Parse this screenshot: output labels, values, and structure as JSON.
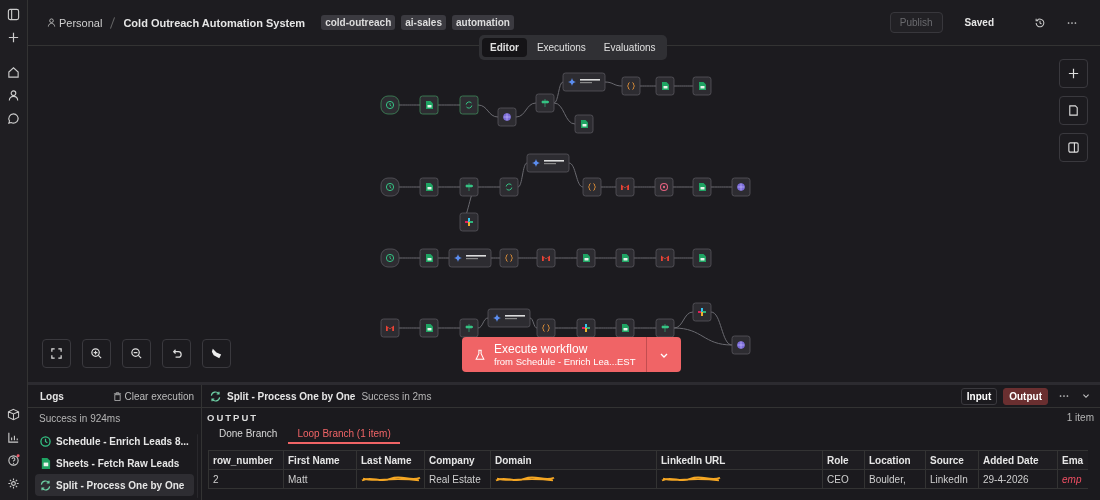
{
  "breadcrumb": {
    "owner": "Personal",
    "title": "Cold Outreach Automation System"
  },
  "tags": [
    "cold-outreach",
    "ai-sales",
    "automation"
  ],
  "actions": {
    "publish": {
      "label": "Publish",
      "disabled": true
    },
    "saved": "Saved"
  },
  "view_tabs": [
    {
      "label": "Editor",
      "selected": true
    },
    {
      "label": "Executions",
      "selected": false
    },
    {
      "label": "Evaluations",
      "selected": false
    }
  ],
  "workflows": [
    {
      "nodes": [
        {
          "kind": "schedule"
        },
        {
          "kind": "sheets"
        },
        {
          "kind": "split"
        },
        {
          "kind": "http"
        },
        {
          "kind": "if"
        },
        {
          "kind": "ai"
        },
        {
          "kind": "code"
        },
        {
          "kind": "sheets"
        },
        {
          "kind": "sheets"
        },
        {
          "kind": "sheets"
        }
      ]
    },
    {
      "nodes": [
        {
          "kind": "schedule"
        },
        {
          "kind": "sheets"
        },
        {
          "kind": "if"
        },
        {
          "kind": "split"
        },
        {
          "kind": "ai"
        },
        {
          "kind": "code"
        },
        {
          "kind": "gmail"
        },
        {
          "kind": "wait"
        },
        {
          "kind": "sheets"
        },
        {
          "kind": "http"
        },
        {
          "kind": "slack"
        }
      ]
    },
    {
      "nodes": [
        {
          "kind": "schedule"
        },
        {
          "kind": "sheets"
        },
        {
          "kind": "ai"
        },
        {
          "kind": "code"
        },
        {
          "kind": "gmail"
        },
        {
          "kind": "sheets"
        },
        {
          "kind": "sheets"
        },
        {
          "kind": "gmail"
        },
        {
          "kind": "sheets"
        }
      ]
    },
    {
      "nodes": [
        {
          "kind": "gmail"
        },
        {
          "kind": "sheets"
        },
        {
          "kind": "if"
        },
        {
          "kind": "ai"
        },
        {
          "kind": "code"
        },
        {
          "kind": "slack"
        },
        {
          "kind": "sheets"
        },
        {
          "kind": "if"
        },
        {
          "kind": "slack"
        },
        {
          "kind": "http"
        }
      ]
    }
  ],
  "execute": {
    "label": "Execute workflow",
    "source": "from Schedule - Enrich Lea...EST"
  },
  "logs": {
    "title": "Logs",
    "clear": "Clear execution",
    "summary": "Success in 924ms",
    "items": [
      {
        "kind": "schedule",
        "label": "Schedule - Enrich Leads 8...",
        "selected": false
      },
      {
        "kind": "sheets",
        "label": "Sheets - Fetch Raw Leads",
        "selected": false
      },
      {
        "kind": "split",
        "label": "Split - Process One by One",
        "selected": true
      }
    ]
  },
  "detail": {
    "node": "Split - Process One by One",
    "status": "Success in 2ms",
    "modes": [
      {
        "label": "Input",
        "selected": false
      },
      {
        "label": "Output",
        "selected": true
      }
    ],
    "section": "OUTPUT",
    "count": "1 item",
    "branches": [
      {
        "label": "Done Branch",
        "selected": false
      },
      {
        "label": "Loop Branch (1 item)",
        "selected": true
      }
    ],
    "table": {
      "columns": [
        "row_number",
        "First Name",
        "Last Name",
        "Company",
        "Domain",
        "LinkedIn URL",
        "Role",
        "Location",
        "Source",
        "Added Date",
        "Ema"
      ],
      "rows": [
        {
          "cells": [
            {
              "text": "2"
            },
            {
              "text": "Matt"
            },
            {
              "redacted": true
            },
            {
              "text": "Real Estate"
            },
            {
              "redacted": true
            },
            {
              "redacted": true
            },
            {
              "text": "CEO"
            },
            {
              "text": "Boulder,"
            },
            {
              "text": "LinkedIn"
            },
            {
              "text": "29-4-2026"
            },
            {
              "text": "emp",
              "kind": "empty"
            }
          ]
        }
      ]
    }
  }
}
